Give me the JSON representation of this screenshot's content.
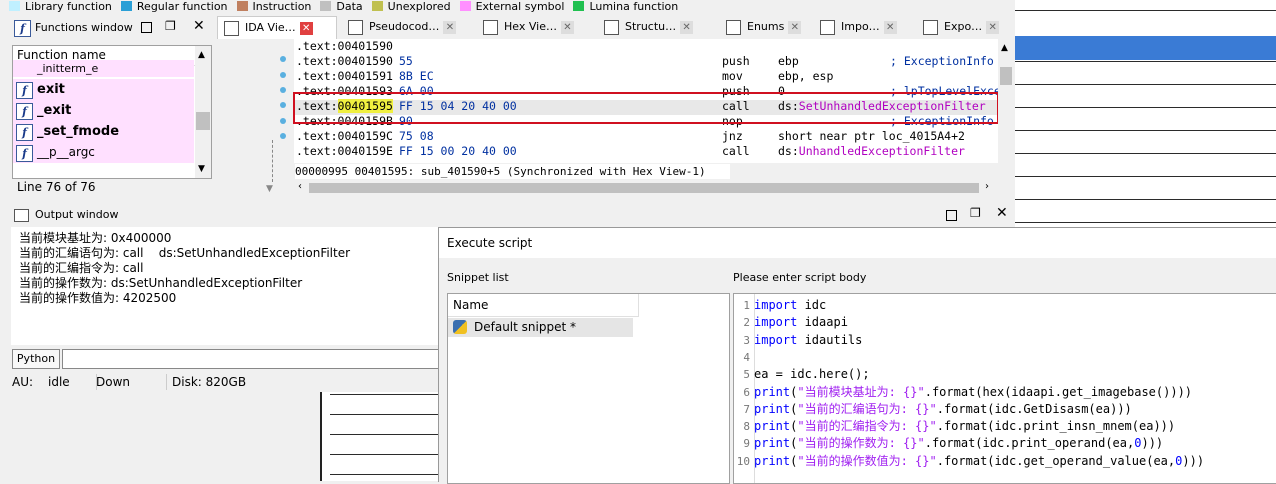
{
  "legend": [
    {
      "label": "Library function",
      "color": "#c0f0ff"
    },
    {
      "label": "Regular function",
      "color": "#2a9fd6"
    },
    {
      "label": "Instruction",
      "color": "#c08060"
    },
    {
      "label": "Data",
      "color": "#c0c0c0"
    },
    {
      "label": "Unexplored",
      "color": "#c0c050"
    },
    {
      "label": "External symbol",
      "color": "#ff90ff"
    },
    {
      "label": "Lumina function",
      "color": "#20c050"
    }
  ],
  "functions_window": {
    "title": "Functions window",
    "header": "Function name",
    "items": [
      "_initterm_e",
      "exit",
      "_exit",
      "_set_fmode",
      "__p__argc"
    ],
    "line_status": "Line 76 of 76"
  },
  "tabs": [
    {
      "label": "IDA Vie…",
      "icon": "ida-view-icon"
    },
    {
      "label": "Pseudocod…",
      "icon": "pseudocode-icon"
    },
    {
      "label": "Hex Vie…",
      "icon": "hex-view-icon"
    },
    {
      "label": "Structu…",
      "icon": "structures-icon"
    },
    {
      "label": "Enums",
      "icon": "enums-icon"
    },
    {
      "label": "Impo…",
      "icon": "imports-icon"
    },
    {
      "label": "Expo…",
      "icon": "exports-icon"
    }
  ],
  "disasm": [
    {
      "addr": ".text:00401590",
      "bytes": "",
      "mnem": "",
      "op": "",
      "comment": ""
    },
    {
      "addr": ".text:00401590",
      "bytes": "55",
      "mnem": "push",
      "op": "ebp",
      "comment": "; ExceptionInfo"
    },
    {
      "addr": ".text:00401591",
      "bytes": "8B EC",
      "mnem": "mov",
      "op": "ebp, esp",
      "comment": ""
    },
    {
      "addr": ".text:00401593",
      "bytes": "6A 00",
      "mnem": "push",
      "op": "0",
      "comment": "; lpTopLevelExce"
    },
    {
      "addr_prefix": ".text:",
      "addr_hl": "00401595",
      "bytes": "FF 15 04 20 40 00",
      "mnem": "call",
      "op_prefix": "ds:",
      "op_ref": "SetUnhandledExceptionFilter"
    },
    {
      "addr": ".text:0040159B",
      "bytes": "90",
      "mnem": "nop",
      "op": "",
      "comment": "; ExceptionInfo"
    },
    {
      "addr": ".text:0040159C",
      "bytes": "75 08",
      "mnem": "jnz",
      "op": "short near ptr loc_4015A4+2",
      "comment": ""
    },
    {
      "addr": ".text:0040159E",
      "bytes": "FF 15 00 20 40 00",
      "mnem": "call",
      "op_prefix": "ds:",
      "op_ref": "UnhandledExceptionFilter"
    }
  ],
  "code_status": "00000995 00401595: sub_401590+5 (Synchronized with Hex View-1)",
  "output": {
    "title": "Output window",
    "lines": [
      "当前模块基址为: 0x400000",
      "当前的汇编语句为: call    ds:SetUnhandledExceptionFilter",
      "当前的汇编指令为: call",
      "当前的操作数为: ds:SetUnhandledExceptionFilter",
      "当前的操作数值为: 4202500"
    ],
    "python_button": "Python"
  },
  "statusbar": {
    "au": "AU:",
    "state": "idle",
    "direction": "Down",
    "disk": "Disk: 820GB"
  },
  "dialog": {
    "title": "Execute script",
    "snippet_label": "Snippet list",
    "body_label": "Please enter script body",
    "snippet_header": "Name",
    "snippet_item": "Default snippet *",
    "script": [
      {
        "n": "1",
        "kw": "import",
        "rest": " idc"
      },
      {
        "n": "2",
        "kw": "import",
        "rest": " idaapi"
      },
      {
        "n": "3",
        "kw": "import",
        "rest": " idautils"
      },
      {
        "n": "4",
        "kw": "",
        "rest": ""
      },
      {
        "n": "5",
        "kw": "",
        "rest": "ea = idc.here();"
      },
      {
        "n": "6",
        "kw": "print",
        "str": "\"当前模块基址为: {}\"",
        "rest": ".format(hex(idaapi.get_imagebase())))"
      },
      {
        "n": "7",
        "kw": "print",
        "str": "\"当前的汇编语句为: {}\"",
        "rest": ".format(idc.GetDisasm(ea)))"
      },
      {
        "n": "8",
        "kw": "print",
        "str": "\"当前的汇编指令为: {}\"",
        "rest": ".format(idc.print_insn_mnem(ea)))"
      },
      {
        "n": "9",
        "kw": "print",
        "str": "\"当前的操作数为: {}\"",
        "rest": ".format(idc.print_operand(ea,",
        "num": "0",
        "tail": ")))"
      },
      {
        "n": "10",
        "kw": "print",
        "str": "\"当前的操作数值为: {}\"",
        "rest": ".format(idc.get_operand_value(ea,",
        "num": "0",
        "tail": ")))"
      }
    ]
  }
}
